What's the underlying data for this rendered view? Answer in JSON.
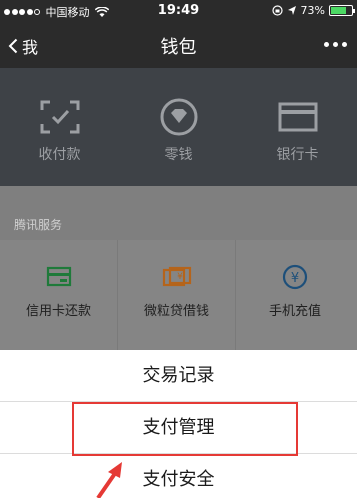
{
  "status_bar": {
    "carrier": "中国移动",
    "time": "19:49",
    "battery": "73%",
    "battery_level": 0.73
  },
  "nav": {
    "back_label": "我",
    "title": "钱包"
  },
  "wallet": {
    "items": [
      {
        "label": "收付款",
        "icon": "scan-pay-icon"
      },
      {
        "label": "零钱",
        "icon": "diamond-coin-icon"
      },
      {
        "label": "银行卡",
        "icon": "bank-card-icon"
      }
    ]
  },
  "services": {
    "header": "腾讯服务",
    "items": [
      {
        "label": "信用卡还款",
        "icon": "credit-card-icon"
      },
      {
        "label": "微粒贷借钱",
        "icon": "loan-icon"
      },
      {
        "label": "手机充值",
        "icon": "yuan-recharge-icon"
      }
    ]
  },
  "action_sheet": {
    "items": [
      {
        "label": "交易记录"
      },
      {
        "label": "支付管理"
      },
      {
        "label": "支付安全"
      }
    ]
  },
  "colors": {
    "annotation": "#e53935",
    "dim_overlay": "#858585"
  }
}
